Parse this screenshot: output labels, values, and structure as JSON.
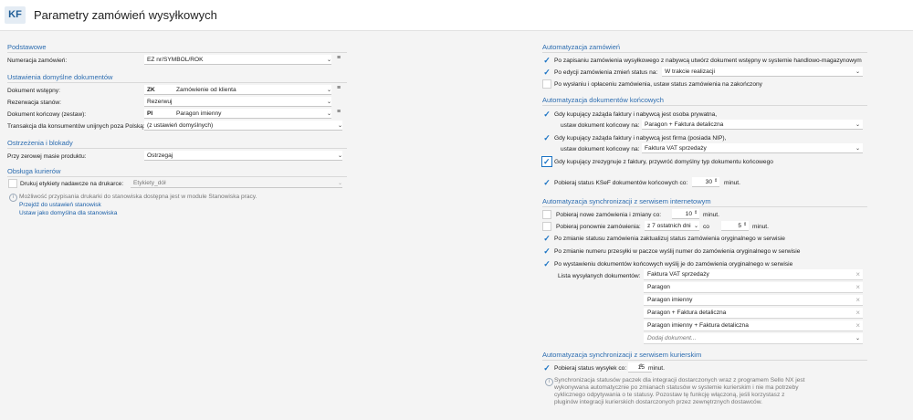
{
  "header": {
    "logo": "KF",
    "title": "Parametry zamówień wysyłkowych"
  },
  "left": {
    "podstawowe": {
      "title": "Podstawowe",
      "numeracja_label": "Numeracja zamówień:",
      "numeracja_value": "EZ nr/SYMBOL/ROK"
    },
    "ustawienia": {
      "title": "Ustawienia domyślne dokumentów",
      "dok_wstepny_label": "Dokument wstępny:",
      "dok_wstepny_code": "ZK",
      "dok_wstepny_value": "Zamówienie od klienta",
      "rezerwacja_label": "Rezerwacja stanów:",
      "rezerwacja_value": "Rezerwuj",
      "dok_koncowy_label": "Dokument końcowy (zestaw):",
      "dok_koncowy_code": "PI",
      "dok_koncowy_value": "Paragon imienny",
      "transakcja_label": "Transakcja dla konsumentów unijnych poza Polską:",
      "transakcja_value": "(z ustawień domyślnych)"
    },
    "ostrzezenia": {
      "title": "Ostrzeżenia i blokady",
      "masa_label": "Przy zerowej masie produktu:",
      "masa_value": "Ostrzegaj"
    },
    "kurierzy": {
      "title": "Obsługa kurierów",
      "drukuj_label": "Drukuj etykiety nadawcze na drukarce:",
      "drukuj_value": "Etykiety_dół",
      "info": "Możliwość przypisania drukarki do stanowiska dostępna jest w module Stanowiska pracy.",
      "link1": "Przejdź do ustawień stanowisk",
      "link2": "Ustaw jako domyślna dla stanowiska"
    }
  },
  "right": {
    "automatyzacja": {
      "title": "Automatyzacja zamówień",
      "opt1": "Po zapisaniu zamówienia wysyłkowego z nabywcą utwórz dokument wstępny w systemie handlowo-magazynowym",
      "opt2": "Po edycji zamówienia zmień status na:",
      "opt2_value": "W trakcie realizacji",
      "opt3": "Po wysłaniu i opłaceniu zamówienia, ustaw status zamówienia na zakończony"
    },
    "koncowe": {
      "title": "Automatyzacja dokumentów końcowych",
      "opt1": "Gdy kupujący zażąda faktury i nabywcą jest osoba prywatna,",
      "opt1_sub": "ustaw dokument końcowy na:",
      "opt1_value": "Paragon + Faktura detaliczna",
      "opt2": "Gdy kupujący zażąda faktury i nabywcą jest firma (posiada NIP),",
      "opt2_sub": "ustaw dokument końcowy na:",
      "opt2_value": "Faktura VAT sprzedaży",
      "opt3": "Gdy kupujący zrezygnuje z faktury, przywróć domyślny typ dokumentu końcowego",
      "ksef": "Pobieraj status KSeF dokumentów końcowych co:",
      "ksef_value": "30",
      "ksef_unit": "minut."
    },
    "sync": {
      "title": "Automatyzacja synchronizacji z serwisem internetowym",
      "nowe": "Pobieraj nowe zamówienia i zmiany co:",
      "nowe_value": "10",
      "nowe_unit": "minut.",
      "ponowne": "Pobieraj ponownie zamówienia:",
      "ponowne_value": "z 7 ostatnich dni",
      "ponowne_co": "co",
      "ponowne_num": "5",
      "ponowne_unit": "minut.",
      "opt1": "Po zmianie statusu zamówienia zaktualizuj status zamówienia oryginalnego w serwisie",
      "opt2": "Po zmianie numeru przesyłki w paczce wyślij numer do zamówienia oryginalnego w serwisie",
      "opt3": "Po wystawieniu dokumentów końcowych wyślij je do zamówienia oryginalnego w serwisie",
      "lista_label": "Lista wysyłanych dokumentów:",
      "lista": [
        "Faktura VAT sprzedaży",
        "Paragon",
        "Paragon imienny",
        "Paragon + Faktura detaliczna",
        "Paragon imienny + Faktura detaliczna"
      ],
      "dodaj_placeholder": "Dodaj dokument..."
    },
    "kurier": {
      "title": "Automatyzacja synchronizacji z serwisem kurierskim",
      "opt1": "Pobieraj status wysyłek co:",
      "opt1_value": "15",
      "opt1_unit": "minut.",
      "info1": "Synchronizacja statusów paczek dla integracji dostarczonych wraz z programem Sello NX jest",
      "info2": "wykonywana automatycznie po zmianach statusów w systemie kurierskim i nie ma potrzeby",
      "info3": "cyklicznego odpytywania o te statusy. Pozostaw tę funkcję włączoną, jeśli korzystasz z",
      "info4": "pluginów integracji kurierskich dostarczonych przez zewnętrznych dostawców."
    }
  },
  "colors": {
    "accent": "#1a73c4",
    "section": "#2b6cb0",
    "link": "#1a5fa8"
  }
}
